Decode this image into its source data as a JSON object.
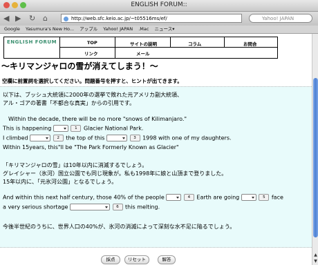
{
  "window": {
    "title": "ENGLISH FORUM::"
  },
  "toolbar": {
    "back": "◀",
    "forward": "▶",
    "reload": "↻",
    "home": "⌂",
    "url": "http://web.sfc.keio.ac.jp/~t05516ms/ef/",
    "search_placeholder": "Yahoo! JAPAN"
  },
  "bookmarks": [
    "Google",
    "Yasumura's New Ho...",
    "アップル",
    "Yahoo! JAPAN",
    ".Mac",
    "ニュース▾"
  ],
  "site_nav": {
    "logo": "ENGLISH FORUM",
    "items": [
      "TOP",
      "サイトの説明",
      "コラム",
      "お問合",
      "リンク",
      "メール"
    ]
  },
  "page": {
    "heading": "〜キリマンジャロの雪が消えてしまう！〜",
    "instruction": "空欄に前置詞を選択してください。問題番号を押すと、ヒントが出てきます。"
  },
  "exercise": {
    "intro_1": "以下は、ブッシュ大統領に2000年の選挙で敗れた元アメリカ副大統領、",
    "intro_2": "アル・ゴアの著書「不都合な真実」からの引用です。",
    "q_line1": "Within the decade, there will be no more \"snows of Kilimanjaro.\"",
    "q_line2_a": "This is happening",
    "q_line2_b": "Glacier National Park.",
    "q_line3_a": "I climbed",
    "q_line3_b": "the top of this",
    "q_line3_c": "1998 with one of my daughters.",
    "q_line4": "Within 15years, this\"ll be \"The Park Formerly Known as Glacier\"",
    "jp_1": "「キリマンジャロの雪」は10年以内に消滅するでしょう。",
    "jp_2": "グレイシャー（氷河）国立公園でも同じ現象が。私も1998年に娘と山頂まで登りました。",
    "jp_3": "15年以内に、「元氷河公園」となるでしょう。",
    "q_line5_a": "And within this next half century, those 40% of the people",
    "q_line5_b": "Earth are going",
    "q_line5_c": "face",
    "q_line6_a": "a very serious shortage",
    "q_line6_b": "this melting.",
    "jp_4": "今後半世紀のうちに、世界人口の40%が、氷河の消滅によって深刻な水不足に陥るでしょう。",
    "hints": [
      "1",
      "2",
      "3",
      "4",
      "5",
      "6"
    ]
  },
  "buttons": {
    "score": "採点",
    "reset": "リセット",
    "answer": "解答"
  }
}
